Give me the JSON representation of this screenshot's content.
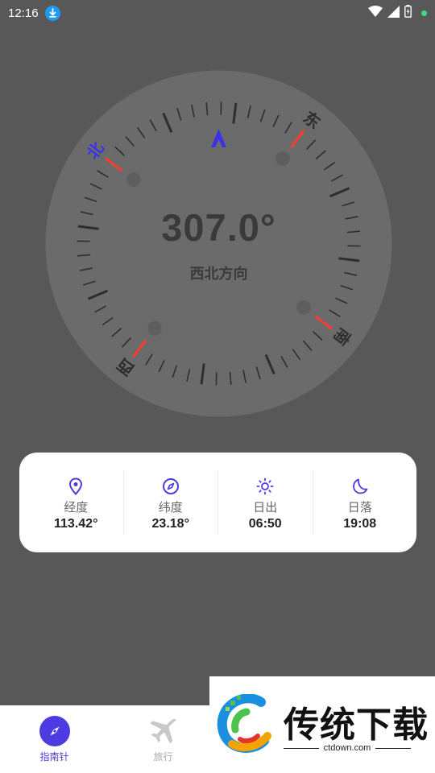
{
  "status_bar": {
    "time": "12:16",
    "download_icon": "download-icon",
    "icons": [
      "wifi-icon",
      "signal-icon",
      "battery-icon",
      "notification-dot"
    ]
  },
  "compass": {
    "heading_degrees": "307.0°",
    "heading_direction": "西北方向",
    "cardinals": {
      "north": "北",
      "east": "东",
      "south": "南",
      "west": "西"
    },
    "dial_rotation_deg": -53,
    "colors": {
      "north_label": "#3b32e8",
      "needle_marker": "#3b32e8",
      "cardinal_tick": "#ff3b30"
    }
  },
  "info": [
    {
      "icon": "location-pin-icon",
      "label": "经度",
      "value": "113.42°"
    },
    {
      "icon": "compass-icon",
      "label": "纬度",
      "value": "23.18°"
    },
    {
      "icon": "sun-icon",
      "label": "日出",
      "value": "06:50"
    },
    {
      "icon": "moon-icon",
      "label": "日落",
      "value": "19:08"
    }
  ],
  "nav": [
    {
      "icon": "compass-nav-icon",
      "label": "指南针",
      "active": true
    },
    {
      "icon": "airplane-icon",
      "label": "旅行",
      "active": false
    }
  ],
  "watermark": {
    "title": "传统下载",
    "url": "ctdown.com"
  },
  "accent_color": "#4b3be0"
}
